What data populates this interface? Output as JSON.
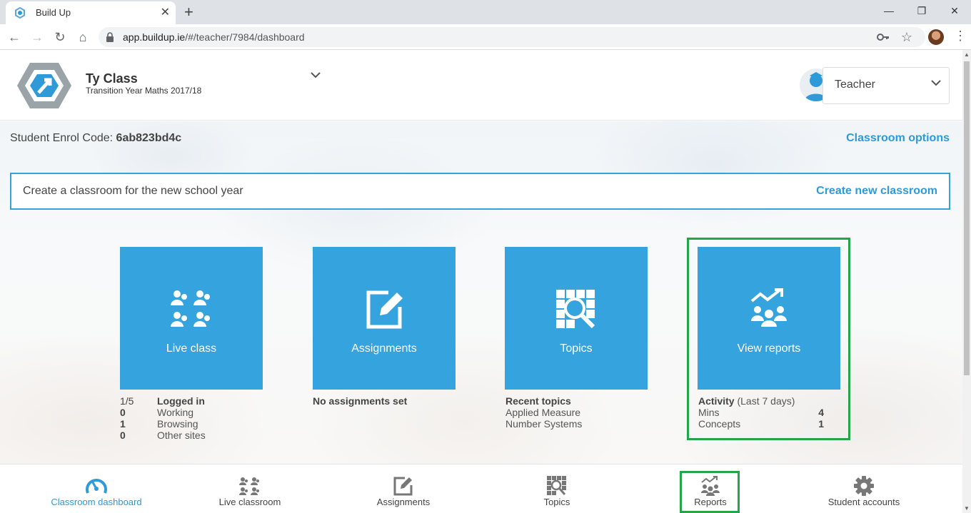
{
  "browser": {
    "tab_title": "Build Up",
    "url_host": "app.buildup.ie",
    "url_path": "/#/teacher/7984/dashboard"
  },
  "header": {
    "class_name": "Ty Class",
    "class_subtitle": "Transition Year Maths 2017/18",
    "user_role": "Teacher"
  },
  "enrol": {
    "label": "Student Enrol Code:",
    "code": "6ab823bd4c"
  },
  "classroom_options": "Classroom options",
  "create_bar": {
    "text": "Create a classroom for the new school year",
    "link": "Create new classroom"
  },
  "tiles": [
    {
      "label": "Live class",
      "icon": "people-grid-icon"
    },
    {
      "label": "Assignments",
      "icon": "edit-icon"
    },
    {
      "label": "Topics",
      "icon": "topics-search-icon"
    },
    {
      "label": "View reports",
      "icon": "reports-icon"
    }
  ],
  "live_stats": {
    "logged_count": "1/5",
    "logged_label": "Logged in",
    "rows": [
      {
        "count": "0",
        "label": "Working"
      },
      {
        "count": "1",
        "label": "Browsing"
      },
      {
        "count": "0",
        "label": "Other sites"
      }
    ]
  },
  "assignments_stats": {
    "text": "No assignments set"
  },
  "topics_stats": {
    "heading": "Recent topics",
    "items": [
      "Applied Measure",
      "Number Systems"
    ]
  },
  "reports_stats": {
    "heading": "Activity",
    "period": "(Last 7 days)",
    "rows": [
      {
        "label": "Mins",
        "value": "4"
      },
      {
        "label": "Concepts",
        "value": "1"
      }
    ]
  },
  "bottom_nav": [
    {
      "label": "Classroom dashboard",
      "icon": "dashboard-icon",
      "active": true
    },
    {
      "label": "Live classroom",
      "icon": "people-grid-icon",
      "active": false
    },
    {
      "label": "Assignments",
      "icon": "edit-icon",
      "active": false
    },
    {
      "label": "Topics",
      "icon": "topics-search-icon",
      "active": false
    },
    {
      "label": "Reports",
      "icon": "reports-icon",
      "active": false
    },
    {
      "label": "Student accounts",
      "icon": "gear-icon",
      "active": false
    }
  ],
  "colors": {
    "accent": "#35a3dd",
    "highlight": "#25a54a"
  }
}
